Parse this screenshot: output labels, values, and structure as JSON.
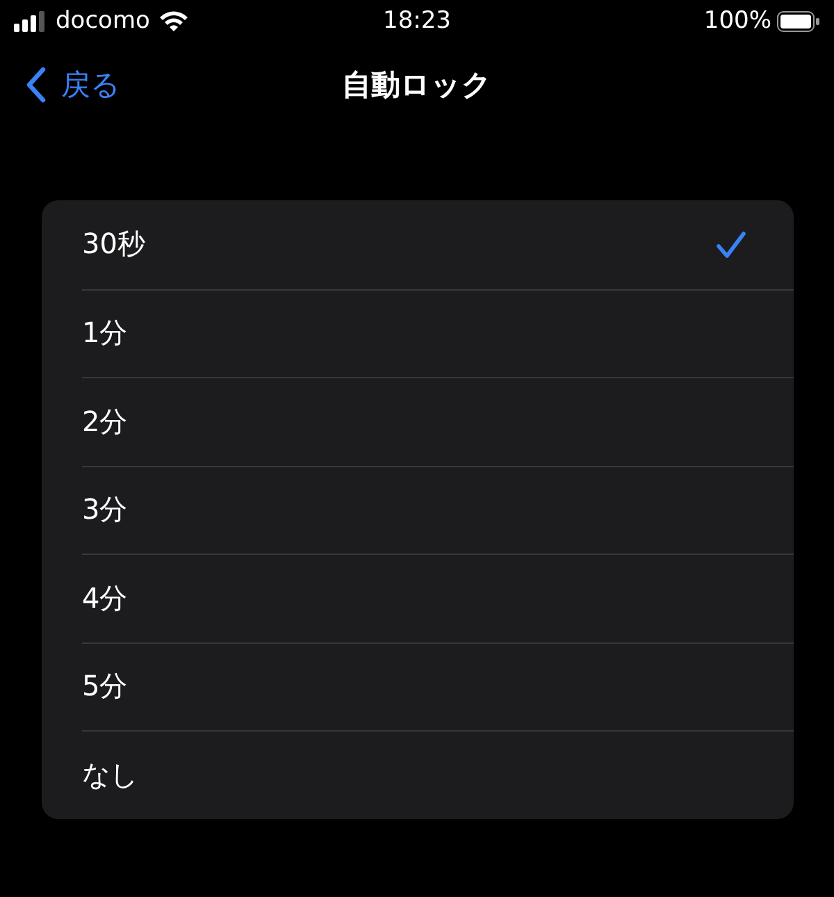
{
  "status_bar": {
    "carrier": "docomo",
    "time": "18:23",
    "battery": "100%"
  },
  "nav": {
    "back": "戻る",
    "title": "自動ロック"
  },
  "options": [
    {
      "label": "30秒",
      "selected": true
    },
    {
      "label": "1分",
      "selected": false
    },
    {
      "label": "2分",
      "selected": false
    },
    {
      "label": "3分",
      "selected": false
    },
    {
      "label": "4分",
      "selected": false
    },
    {
      "label": "5分",
      "selected": false
    },
    {
      "label": "なし",
      "selected": false
    }
  ]
}
